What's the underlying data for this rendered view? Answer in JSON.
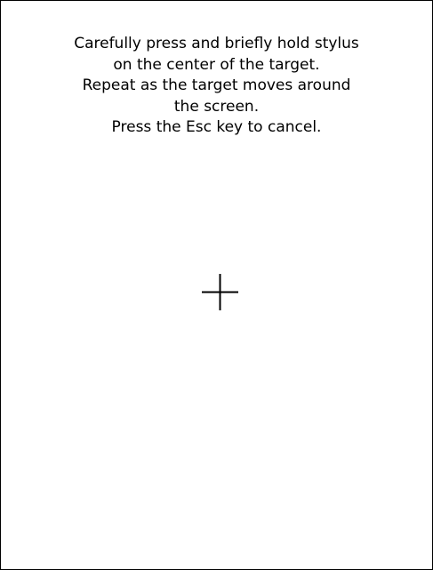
{
  "calibration": {
    "instructions": [
      "Carefully press and briefly hold stylus",
      "on the center of the target.",
      "Repeat as the target moves around",
      "the screen.",
      "Press the Esc key to cancel."
    ],
    "target_icon": "crosshair-icon"
  },
  "colors": {
    "background": "#ffffff",
    "text": "#000000",
    "crosshair": "#000000",
    "border": "#000000"
  }
}
